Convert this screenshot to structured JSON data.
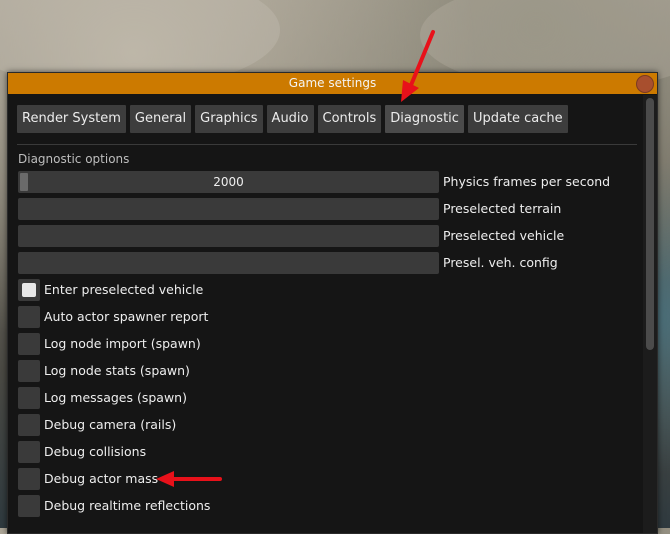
{
  "window": {
    "title": "Game settings"
  },
  "tabs": [
    {
      "label": "Render System"
    },
    {
      "label": "General"
    },
    {
      "label": "Graphics"
    },
    {
      "label": "Audio"
    },
    {
      "label": "Controls"
    },
    {
      "label": "Diagnostic",
      "active": true
    },
    {
      "label": "Update cache"
    }
  ],
  "section": {
    "label": "Diagnostic options"
  },
  "fields": {
    "physics": {
      "value": "2000",
      "label": "Physics frames per second"
    },
    "terrain": {
      "value": "",
      "label": "Preselected terrain"
    },
    "vehicle": {
      "value": "",
      "label": "Preselected vehicle"
    },
    "config": {
      "value": "",
      "label": "Presel. veh. config"
    }
  },
  "checkboxes": [
    {
      "label": "Enter preselected vehicle",
      "checked": true
    },
    {
      "label": "Auto actor spawner report",
      "checked": false
    },
    {
      "label": "Log node import (spawn)",
      "checked": false
    },
    {
      "label": "Log node stats (spawn)",
      "checked": false
    },
    {
      "label": "Log messages (spawn)",
      "checked": false
    },
    {
      "label": "Debug camera (rails)",
      "checked": false
    },
    {
      "label": "Debug collisions",
      "checked": false
    },
    {
      "label": "Debug actor mass",
      "checked": false
    },
    {
      "label": "Debug realtime reflections",
      "checked": false
    }
  ],
  "colors": {
    "titlebar": "#cc7a00",
    "annotation_arrow": "#e8111a"
  }
}
